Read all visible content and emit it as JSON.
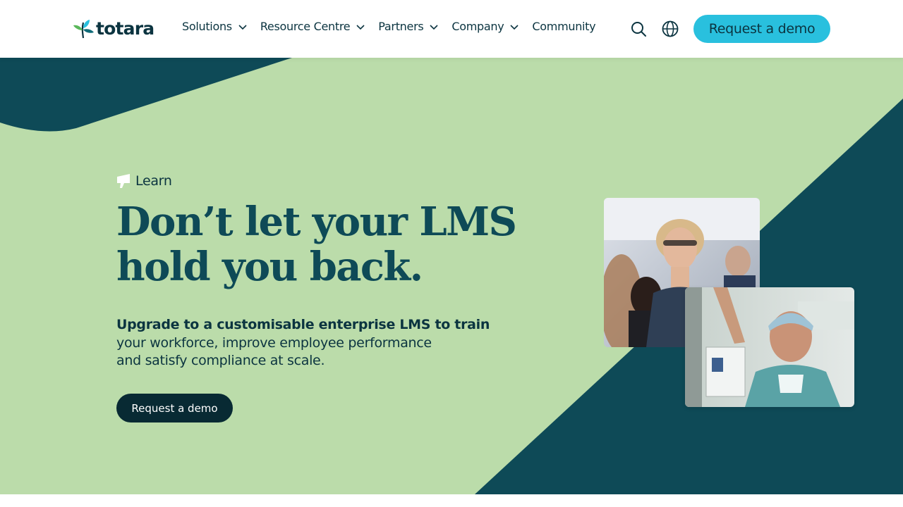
{
  "brand": {
    "name": "totara",
    "accent": "#29c0de",
    "dark_teal": "#0e4a57",
    "mint": "#bbdcaa"
  },
  "nav": {
    "items": [
      {
        "label": "Solutions",
        "has_dropdown": true
      },
      {
        "label": "Resource Centre",
        "has_dropdown": true
      },
      {
        "label": "Partners",
        "has_dropdown": true
      },
      {
        "label": "Company",
        "has_dropdown": true
      },
      {
        "label": "Community",
        "has_dropdown": false
      }
    ],
    "search_icon": "search-icon",
    "language_icon": "globe-icon",
    "cta_label": "Request a demo"
  },
  "hero": {
    "eyebrow": "Learn",
    "eyebrow_icon": "megaphone-icon",
    "headline_line1": "Don’t let your LMS",
    "headline_line2": "hold you back.",
    "subtext_bold": "Upgrade to a customisable enterprise LMS to train",
    "subtext_line2": "your workforce, improve employee performance",
    "subtext_line3": "and satisfy compliance at scale.",
    "cta_label": "Request a demo"
  }
}
